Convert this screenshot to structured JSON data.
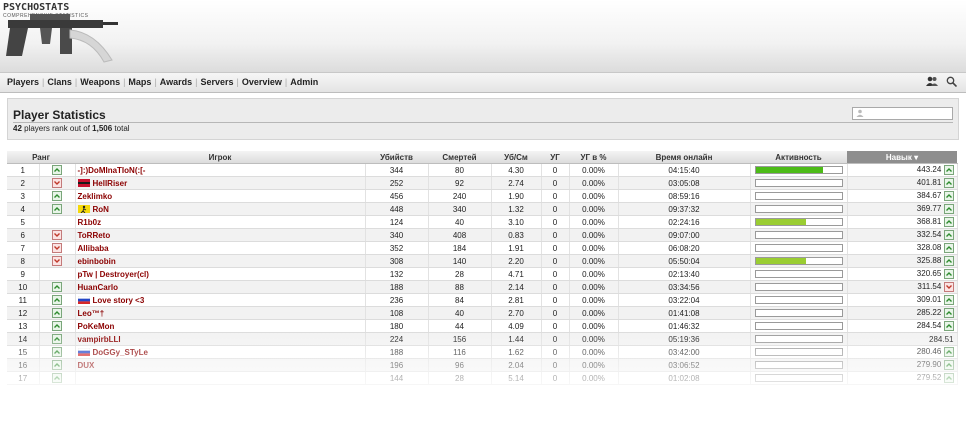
{
  "header": {
    "logo_text": "PSYCHOSTATS",
    "logo_subtitle": "COMPREHENSIVE STATISTICS"
  },
  "nav": {
    "items": [
      "Players",
      "Clans",
      "Weapons",
      "Maps",
      "Awards",
      "Servers",
      "Overview",
      "Admin"
    ]
  },
  "panel": {
    "title": "Player Statistics",
    "ranked_count": "42",
    "ranked_mid": " players rank out of ",
    "total": "1,506",
    "total_suffix": " total"
  },
  "table": {
    "headers": [
      "Ранг",
      "Игрок",
      "Убийств",
      "Смертей",
      "Уб/См",
      "УГ",
      "УГ в %",
      "Время онлайн",
      "Активность",
      "Навык"
    ],
    "rows": [
      {
        "rank": "1",
        "trend": "up",
        "flag": "",
        "name": "-]:)DoMInaTIoN(:[-",
        "kills": "344",
        "deaths": "80",
        "kd": "4.30",
        "hs": "0",
        "hsp": "0.00%",
        "time": "04:15:40",
        "activity": 0.78,
        "skill": "443.24",
        "skill_trend": "up"
      },
      {
        "rank": "2",
        "trend": "down",
        "flag": "tr",
        "name": "HellRiser",
        "kills": "252",
        "deaths": "92",
        "kd": "2.74",
        "hs": "0",
        "hsp": "0.00%",
        "time": "03:05:08",
        "activity": 0,
        "skill": "401.81",
        "skill_trend": "up"
      },
      {
        "rank": "3",
        "trend": "up",
        "flag": "",
        "name": "Zeklimko",
        "kills": "456",
        "deaths": "240",
        "kd": "1.90",
        "hs": "0",
        "hsp": "0.00%",
        "time": "08:59:16",
        "activity": 0,
        "skill": "384.67",
        "skill_trend": "up"
      },
      {
        "rank": "4",
        "trend": "up",
        "flag": "run",
        "name": "RoN",
        "kills": "448",
        "deaths": "340",
        "kd": "1.32",
        "hs": "0",
        "hsp": "0.00%",
        "time": "09:37:32",
        "activity": 0,
        "skill": "369.77",
        "skill_trend": "up"
      },
      {
        "rank": "5",
        "trend": "",
        "flag": "",
        "name": "R1b0z",
        "kills": "124",
        "deaths": "40",
        "kd": "3.10",
        "hs": "0",
        "hsp": "0.00%",
        "time": "02:24:16",
        "activity": 0.58,
        "skill": "368.81",
        "skill_trend": "up"
      },
      {
        "rank": "6",
        "trend": "down",
        "flag": "",
        "name": "ToRReto",
        "kills": "340",
        "deaths": "408",
        "kd": "0.83",
        "hs": "0",
        "hsp": "0.00%",
        "time": "09:07:00",
        "activity": 0,
        "skill": "332.54",
        "skill_trend": "up"
      },
      {
        "rank": "7",
        "trend": "down",
        "flag": "",
        "name": "Allibaba",
        "kills": "352",
        "deaths": "184",
        "kd": "1.91",
        "hs": "0",
        "hsp": "0.00%",
        "time": "06:08:20",
        "activity": 0,
        "skill": "328.08",
        "skill_trend": "up"
      },
      {
        "rank": "8",
        "trend": "down",
        "flag": "",
        "name": "ebinbobin",
        "kills": "308",
        "deaths": "140",
        "kd": "2.20",
        "hs": "0",
        "hsp": "0.00%",
        "time": "05:50:04",
        "activity": 0.58,
        "skill": "325.88",
        "skill_trend": "up"
      },
      {
        "rank": "9",
        "trend": "",
        "flag": "",
        "name": "pTw | Destroyer(cl)",
        "kills": "132",
        "deaths": "28",
        "kd": "4.71",
        "hs": "0",
        "hsp": "0.00%",
        "time": "02:13:40",
        "activity": 0,
        "skill": "320.65",
        "skill_trend": "up"
      },
      {
        "rank": "10",
        "trend": "up",
        "flag": "",
        "name": "HuanCarlo",
        "kills": "188",
        "deaths": "88",
        "kd": "2.14",
        "hs": "0",
        "hsp": "0.00%",
        "time": "03:34:56",
        "activity": 0,
        "skill": "311.54",
        "skill_trend": "down"
      },
      {
        "rank": "11",
        "trend": "up",
        "flag": "ru",
        "name": "Love story <3",
        "kills": "236",
        "deaths": "84",
        "kd": "2.81",
        "hs": "0",
        "hsp": "0.00%",
        "time": "03:22:04",
        "activity": 0,
        "skill": "309.01",
        "skill_trend": "up"
      },
      {
        "rank": "12",
        "trend": "up",
        "flag": "",
        "name": "Leo™†",
        "kills": "108",
        "deaths": "40",
        "kd": "2.70",
        "hs": "0",
        "hsp": "0.00%",
        "time": "01:41:08",
        "activity": 0,
        "skill": "285.22",
        "skill_trend": "up"
      },
      {
        "rank": "13",
        "trend": "up",
        "flag": "",
        "name": "PoKeMon",
        "kills": "180",
        "deaths": "44",
        "kd": "4.09",
        "hs": "0",
        "hsp": "0.00%",
        "time": "01:46:32",
        "activity": 0,
        "skill": "284.54",
        "skill_trend": "up"
      },
      {
        "rank": "14",
        "trend": "up",
        "flag": "",
        "name": "vampirbLLl",
        "kills": "224",
        "deaths": "156",
        "kd": "1.44",
        "hs": "0",
        "hsp": "0.00%",
        "time": "05:19:36",
        "activity": 0,
        "skill": "284.51",
        "skill_trend": ""
      },
      {
        "rank": "15",
        "trend": "up",
        "flag": "ru",
        "name": "DoGGy_STyLe",
        "kills": "188",
        "deaths": "116",
        "kd": "1.62",
        "hs": "0",
        "hsp": "0.00%",
        "time": "03:42:00",
        "activity": 0,
        "skill": "280.46",
        "skill_trend": "up"
      },
      {
        "rank": "16",
        "trend": "up",
        "flag": "",
        "name": "DUX",
        "kills": "196",
        "deaths": "96",
        "kd": "2.04",
        "hs": "0",
        "hsp": "0.00%",
        "time": "03:06:52",
        "activity": 0,
        "skill": "279.90",
        "skill_trend": "up"
      },
      {
        "rank": "17",
        "trend": "up",
        "flag": "",
        "name": "",
        "kills": "144",
        "deaths": "28",
        "kd": "5.14",
        "hs": "0",
        "hsp": "0.00%",
        "time": "01:02:08",
        "activity": 0,
        "skill": "279.52",
        "skill_trend": "up"
      }
    ]
  },
  "colors": {
    "accent": "#8b0000",
    "activity_green": "#4cbb17",
    "activity_yellow": "#9acd32"
  }
}
